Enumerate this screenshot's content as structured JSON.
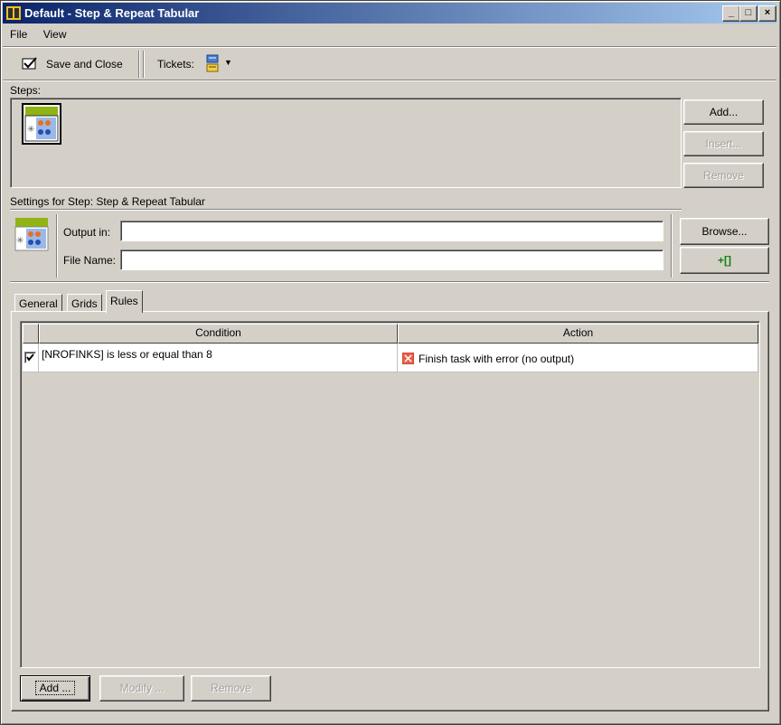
{
  "window": {
    "title": "Default - Step & Repeat Tabular",
    "min": "_",
    "max": "□",
    "close": "×"
  },
  "menu": {
    "file": "File",
    "view": "View"
  },
  "toolbar": {
    "save_close": "Save and Close",
    "tickets_label": "Tickets:"
  },
  "steps": {
    "label": "Steps:",
    "add": "Add...",
    "insert": "Insert...",
    "remove": "Remove"
  },
  "settings": {
    "header": "Settings for Step: Step & Repeat Tabular",
    "output_label": "Output in:",
    "output_value": "",
    "filename_label": "File Name:",
    "filename_value": "",
    "browse": "Browse...",
    "add_var": "+[]"
  },
  "tabs": [
    {
      "label": "General"
    },
    {
      "label": "Grids"
    },
    {
      "label": "Rules",
      "active": true
    }
  ],
  "rules_table": {
    "columns": [
      "Condition",
      "Action"
    ],
    "rows": [
      {
        "checked": true,
        "condition": "[NROFINKS] is less or equal than 8",
        "action": "Finish task with error (no output)"
      }
    ]
  },
  "rules_buttons": {
    "add": "Add ...",
    "modify": "Modify ...",
    "remove": "Remove"
  },
  "colors": {
    "title_start": "#0a246a",
    "title_end": "#a6caf0",
    "face": "#d4d0c8",
    "accent_green": "#8fb414",
    "error_red": "#e8604a"
  }
}
